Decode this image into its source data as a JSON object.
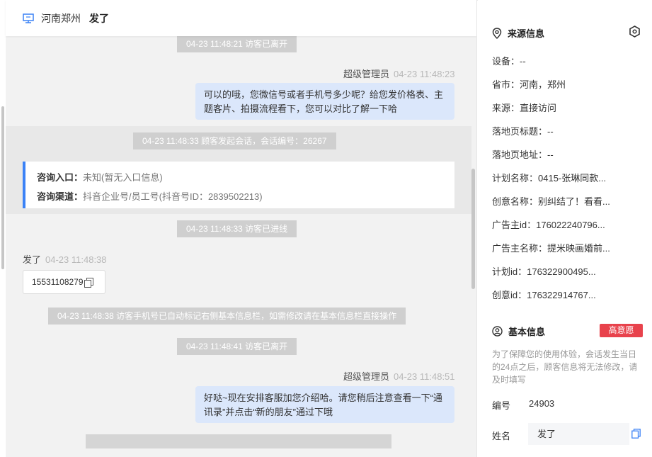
{
  "header": {
    "location": "河南郑州",
    "visitor_name": "发了"
  },
  "messages": {
    "sys1": "04-23 11:48:21 访客已离开",
    "agent1_name": "超级管理员",
    "agent1_time": "04-23 11:48:23",
    "agent1_line1": "可以的哦，您微信号或者手机号多少呢？给您发价格表、主",
    "agent1_line2": "题客片、拍摄流程看下，您可以对比了解一下哈",
    "sys2": "04-23 11:48:33 顾客发起会话，会话编号：26267",
    "entry_label": "咨询入口：",
    "entry_value": "未知(暂无入口信息)",
    "channel_label": "咨询渠道：",
    "channel_value": "抖音企业号/员工号(抖音号ID：2839502213)",
    "sys3": "04-23 11:48:33 访客已进线",
    "visitor_name": "发了",
    "visitor_time": "04-23 11:48:38",
    "phone": "15531108279",
    "sys4": "04-23 11:48:38 访客手机号已自动标记右侧基本信息栏，如需修改请在基本信息栏直接操作",
    "sys5": "04-23 11:48:41 访客已离开",
    "agent2_name": "超级管理员",
    "agent2_time": "04-23 11:48:51",
    "agent2_line1": "好哒~现在安排客服加您介绍哈。请您稍后注意查看一下“通",
    "agent2_line2": "讯录”并点击“新的朋友”通过下哦"
  },
  "source": {
    "title": "来源信息",
    "fields": [
      "设备：--",
      "省市：河南，郑州",
      "来源：直接访问",
      "落地页标题：--",
      "落地页地址：--",
      "计划名称：0415-张琳同款...",
      "创意名称：别纠结了！看看...",
      "广告主id：176022240796...",
      "广告主名称：提米映画婚前...",
      "计划id：176322900495...",
      "创意id：176322914767..."
    ]
  },
  "basic": {
    "title": "基本信息",
    "badge": "高意愿",
    "note": "为了保障您的使用体验，会话发生当日的24点之后，顾客信息将无法修改，请及时填写",
    "id_label": "编号",
    "id_value": "24903",
    "name_label": "姓名",
    "name_value": "发了"
  },
  "colors": {
    "accent": "#3b82f6",
    "badge": "#e8424c",
    "bubble": "#dbe7fb"
  }
}
